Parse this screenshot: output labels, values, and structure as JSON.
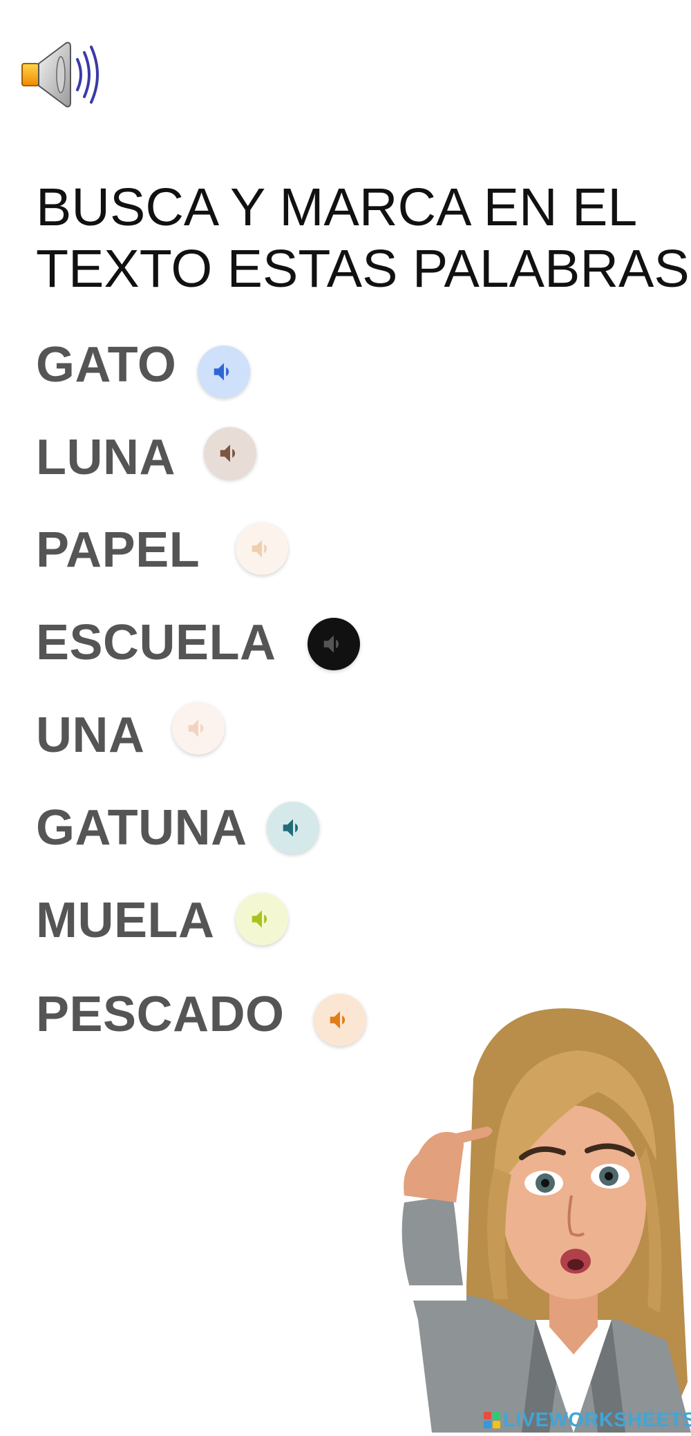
{
  "instruction": {
    "line1": "BUSCA Y MARCA EN EL",
    "line2": "TEXTO ESTAS PALABRAS:"
  },
  "words": [
    {
      "label": "GATO",
      "btn_color": "#cfe0fb",
      "icon_color": "#2f66d6"
    },
    {
      "label": "LUNA",
      "btn_color": "#e8ddd6",
      "icon_color": "#7a5643"
    },
    {
      "label": "PAPEL",
      "btn_color": "#fcf3ec",
      "icon_color": "#f0cfae"
    },
    {
      "label": "ESCUELA",
      "btn_color": "#111111",
      "icon_color": "#555555"
    },
    {
      "label": "UNA",
      "btn_color": "#fcf3ee",
      "icon_color": "#f2d3c0"
    },
    {
      "label": "GATUNA",
      "btn_color": "#d5e8ea",
      "icon_color": "#1f6d77"
    },
    {
      "label": "MUELA",
      "btn_color": "#f4f8d2",
      "icon_color": "#a8c41c"
    },
    {
      "label": "PESCADO",
      "btn_color": "#fbe6d3",
      "icon_color": "#e17d18"
    }
  ],
  "icons": {
    "main_speaker": "speaker-icon",
    "audio": "volume-icon"
  },
  "branding": {
    "text": "LIVEWORKSHEETS"
  },
  "colors": {
    "word_text": "#555555",
    "instruction_text": "#111111",
    "brand": "#3fa6d8"
  }
}
